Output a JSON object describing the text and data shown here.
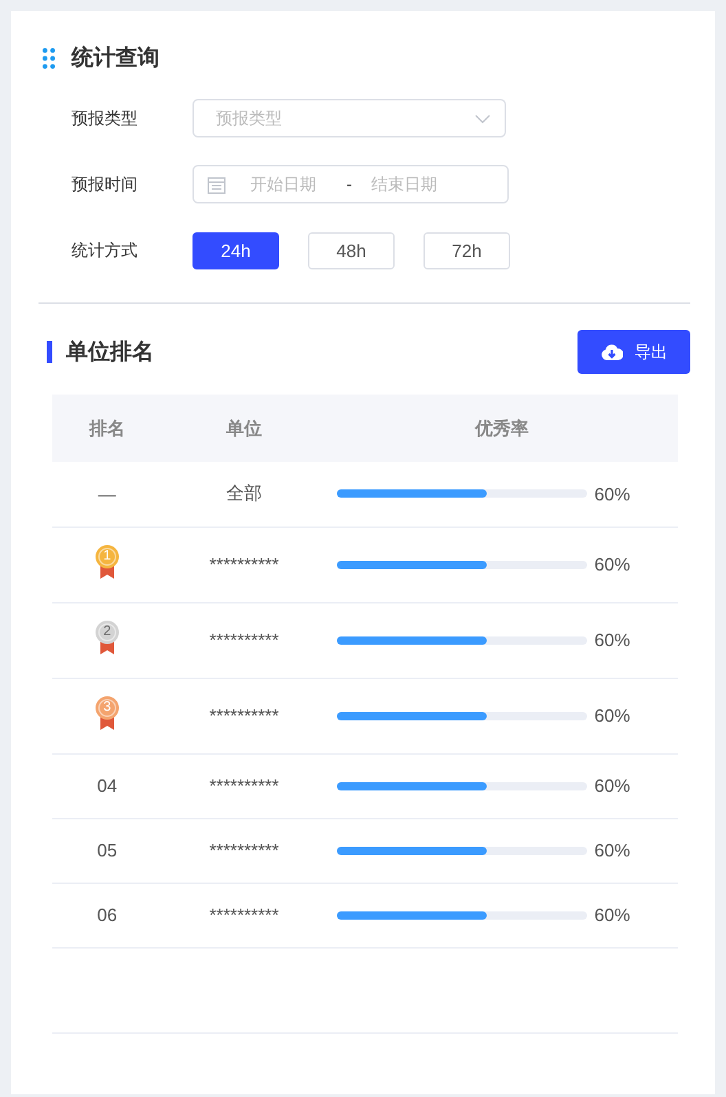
{
  "query": {
    "title": "统计查询",
    "fields": [
      {
        "kind": "select",
        "label": "预报类型",
        "placeholder": "预报类型"
      },
      {
        "kind": "daterange",
        "label": "预报时间",
        "start_placeholder": "开始日期",
        "separator": "-",
        "end_placeholder": "结束日期"
      },
      {
        "kind": "options",
        "label": "统计方式",
        "options": [
          {
            "label": "24h",
            "selected": true
          },
          {
            "label": "48h",
            "selected": false
          },
          {
            "label": "72h",
            "selected": false
          }
        ]
      }
    ]
  },
  "ranking": {
    "title": "单位排名",
    "export_button": "导出",
    "columns": [
      "排名",
      "单位",
      "优秀率"
    ],
    "rows": [
      {
        "kind": "text",
        "rank": "—",
        "unit": "全部",
        "level": 0.6,
        "rate": "60%"
      },
      {
        "kind": "medal",
        "rank": "1",
        "color": "#f5b53f",
        "unit": "**********",
        "level": 0.6,
        "rate": "60%"
      },
      {
        "kind": "medal",
        "rank": "2",
        "color": "#d3d3d3",
        "unit": "**********",
        "level": 0.6,
        "rate": "60%"
      },
      {
        "kind": "medal",
        "rank": "3",
        "color": "#f4a46e",
        "unit": "**********",
        "level": 0.6,
        "rate": "60%"
      },
      {
        "kind": "text",
        "rank": "04",
        "unit": "**********",
        "level": 0.6,
        "rate": "60%"
      },
      {
        "kind": "text",
        "rank": "05",
        "unit": "**********",
        "level": 0.6,
        "rate": "60%"
      },
      {
        "kind": "text",
        "rank": "06",
        "unit": "**********",
        "level": 0.6,
        "rate": "60%"
      }
    ]
  }
}
